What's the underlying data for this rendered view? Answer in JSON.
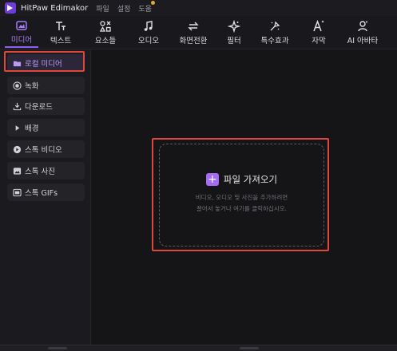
{
  "app": {
    "title": "HitPaw Edimakor"
  },
  "menu": [
    "파일",
    "설정",
    "도움"
  ],
  "toolbar": [
    {
      "label": "미디어",
      "icon": "media-icon",
      "active": true
    },
    {
      "label": "텍스트",
      "icon": "text-icon"
    },
    {
      "label": "요소들",
      "icon": "elements-icon"
    },
    {
      "label": "오디오",
      "icon": "audio-icon"
    },
    {
      "label": "화면전환",
      "icon": "transition-icon"
    },
    {
      "label": "필터",
      "icon": "filter-icon"
    },
    {
      "label": "특수효과",
      "icon": "effects-icon"
    },
    {
      "label": "자막",
      "icon": "subtitle-icon"
    },
    {
      "label": "AI 아바타",
      "icon": "ai-avatar-icon"
    }
  ],
  "sidebar": {
    "items": [
      {
        "label": "로컬 미디어",
        "icon": "folder-icon",
        "active": true
      },
      {
        "label": "녹화",
        "icon": "record-icon"
      },
      {
        "label": "다운로드",
        "icon": "download-icon"
      },
      {
        "label": "배경",
        "icon": "play-arrow-icon"
      },
      {
        "label": "스톡 비디오",
        "icon": "video-play-icon"
      },
      {
        "label": "스톡 사진",
        "icon": "image-icon"
      },
      {
        "label": "스톡 GIFs",
        "icon": "gif-icon"
      }
    ]
  },
  "dropzone": {
    "import_label": "파일 가져오기",
    "hint_line1": "비디오, 오디오 및 사진을 추가하려면",
    "hint_line2": "끌어서 놓거나 여기를 클릭하십시오."
  },
  "colors": {
    "accent": "#8f5ef2",
    "highlight": "#e0473c",
    "background": "#151518"
  }
}
